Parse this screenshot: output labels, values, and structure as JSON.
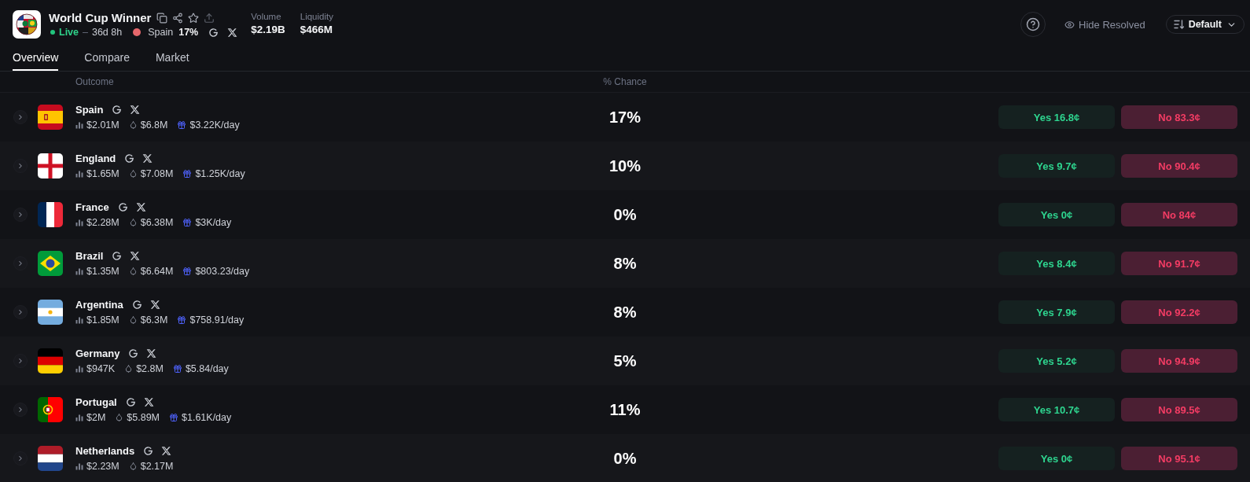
{
  "market": {
    "title": "World Cup Winner",
    "status": "Live",
    "dash": "–",
    "time_left": "36d 8h",
    "leader": {
      "name": "Spain",
      "chance": "17%",
      "color": "#e5676b"
    },
    "stats": [
      {
        "label": "Volume",
        "value": "$2.19B"
      },
      {
        "label": "Liquidity",
        "value": "$466M"
      }
    ]
  },
  "toolbar": {
    "hide_resolved": "Hide Resolved",
    "sort": "Default"
  },
  "tabs": [
    {
      "label": "Overview",
      "selected": true
    },
    {
      "label": "Compare",
      "selected": false
    },
    {
      "label": "Market",
      "selected": false
    }
  ],
  "table": {
    "columns": [
      "Outcome",
      "% Chance"
    ],
    "rows": [
      {
        "name": "Spain",
        "flag": {
          "kind": "spain"
        },
        "volume": "$2.01M",
        "liquidity": "$6.8M",
        "rewards": "$3.22K/day",
        "chance": "17%",
        "yes": "Yes 16.8¢",
        "no": "No 83.3¢"
      },
      {
        "name": "England",
        "flag": {
          "kind": "england"
        },
        "volume": "$1.65M",
        "liquidity": "$7.08M",
        "rewards": "$1.25K/day",
        "chance": "10%",
        "yes": "Yes 9.7¢",
        "no": "No 90.4¢"
      },
      {
        "name": "France",
        "flag": {
          "kind": "france"
        },
        "volume": "$2.28M",
        "liquidity": "$6.38M",
        "rewards": "$3K/day",
        "chance": "0%",
        "yes": "Yes 0¢",
        "no": "No 84¢"
      },
      {
        "name": "Brazil",
        "flag": {
          "kind": "brazil"
        },
        "volume": "$1.35M",
        "liquidity": "$6.64M",
        "rewards": "$803.23/day",
        "chance": "8%",
        "yes": "Yes 8.4¢",
        "no": "No 91.7¢"
      },
      {
        "name": "Argentina",
        "flag": {
          "kind": "argentina"
        },
        "volume": "$1.85M",
        "liquidity": "$6.3M",
        "rewards": "$758.91/day",
        "chance": "8%",
        "yes": "Yes 7.9¢",
        "no": "No 92.2¢"
      },
      {
        "name": "Germany",
        "flag": {
          "kind": "germany"
        },
        "volume": "$947K",
        "liquidity": "$2.8M",
        "rewards": "$5.84/day",
        "chance": "5%",
        "yes": "Yes 5.2¢",
        "no": "No 94.9¢"
      },
      {
        "name": "Portugal",
        "flag": {
          "kind": "portugal"
        },
        "volume": "$2M",
        "liquidity": "$5.89M",
        "rewards": "$1.61K/day",
        "chance": "11%",
        "yes": "Yes 10.7¢",
        "no": "No 89.5¢"
      },
      {
        "name": "Netherlands",
        "flag": {
          "kind": "netherlands"
        },
        "volume": "$2.23M",
        "liquidity": "$2.17M",
        "chance": "0%",
        "yes": "Yes 0¢",
        "no": "No 95.1¢"
      }
    ]
  }
}
